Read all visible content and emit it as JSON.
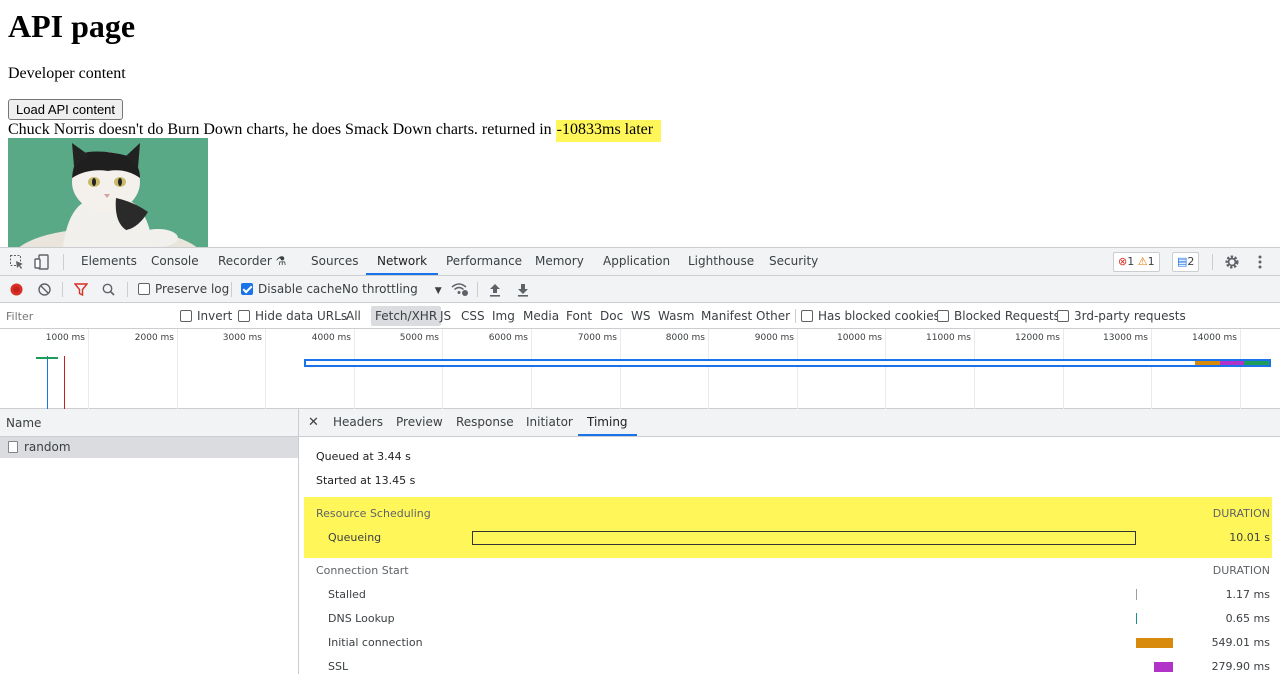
{
  "page": {
    "title": "API page",
    "subtitle": "Developer content",
    "button_label": "Load API content",
    "joke_text": "Chuck Norris doesn't do Burn Down charts, he does Smack Down charts. returned in ",
    "returned_time": "-10833ms later"
  },
  "devtools": {
    "tabs": [
      "Elements",
      "Console",
      "Recorder",
      "Sources",
      "Network",
      "Performance",
      "Memory",
      "Application",
      "Lighthouse",
      "Security"
    ],
    "active_tab": "Network",
    "badges": {
      "errors": "1",
      "warnings": "1",
      "messages": "2"
    },
    "toolbar": {
      "preserve_log": "Preserve log",
      "disable_cache": "Disable cache",
      "throttling": "No throttling"
    },
    "filter": {
      "placeholder": "Filter",
      "invert": "Invert",
      "hide_data_urls": "Hide data URLs",
      "types": [
        "All",
        "Fetch/XHR",
        "JS",
        "CSS",
        "Img",
        "Media",
        "Font",
        "Doc",
        "WS",
        "Wasm",
        "Manifest",
        "Other"
      ],
      "active_type": "Fetch/XHR",
      "has_blocked_cookies": "Has blocked cookies",
      "blocked_requests": "Blocked Requests",
      "third_party": "3rd-party requests"
    },
    "overview_ticks": [
      "1000 ms",
      "2000 ms",
      "3000 ms",
      "4000 ms",
      "5000 ms",
      "6000 ms",
      "7000 ms",
      "8000 ms",
      "9000 ms",
      "10000 ms",
      "11000 ms",
      "12000 ms",
      "13000 ms",
      "14000 ms"
    ],
    "requests_panel": {
      "header": "Name",
      "rows": [
        "random"
      ]
    },
    "detail_tabs": [
      "Headers",
      "Preview",
      "Response",
      "Initiator",
      "Timing"
    ],
    "active_detail_tab": "Timing",
    "timing": {
      "queued_at": "Queued at 3.44 s",
      "started_at": "Started at 13.45 s",
      "resource_scheduling": {
        "title": "Resource Scheduling",
        "duration_label": "DURATION",
        "rows": [
          {
            "label": "Queueing",
            "value": "10.01 s"
          }
        ]
      },
      "connection_start": {
        "title": "Connection Start",
        "duration_label": "DURATION",
        "rows": [
          {
            "label": "Stalled",
            "value": "1.17 ms"
          },
          {
            "label": "DNS Lookup",
            "value": "0.65 ms"
          },
          {
            "label": "Initial connection",
            "value": "549.01 ms"
          },
          {
            "label": "SSL",
            "value": "279.90 ms"
          }
        ]
      }
    },
    "colors": {
      "accent": "#1a73e8",
      "highlight": "#fff75a",
      "connect": "#d88a0c",
      "ssl": "#b233c8",
      "send": "#1e9c5a"
    }
  }
}
